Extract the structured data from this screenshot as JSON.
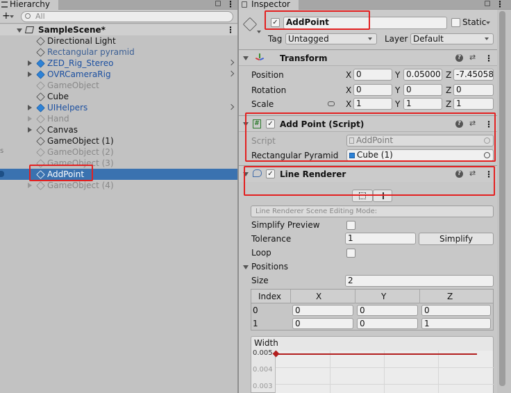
{
  "hierarchy": {
    "tab_label": "Hierarchy",
    "search_placeholder": "All",
    "scene_name": "SampleScene*",
    "items": [
      {
        "label": "Directional Light",
        "style": "normal"
      },
      {
        "label": "Rectangular pyramid",
        "style": "blue"
      },
      {
        "label": "ZED_Rig_Stereo",
        "style": "prefab"
      },
      {
        "label": "OVRCameraRig",
        "style": "prefab"
      },
      {
        "label": "GameObject",
        "style": "gray"
      },
      {
        "label": "Cube",
        "style": "normal"
      },
      {
        "label": "UIHelpers",
        "style": "prefab"
      },
      {
        "label": "Hand",
        "style": "gray"
      },
      {
        "label": "Canvas",
        "style": "normal"
      },
      {
        "label": "GameObject (1)",
        "style": "normal"
      },
      {
        "label": "GameObject (2)",
        "style": "gray"
      },
      {
        "label": "GameObject (3)",
        "style": "gray"
      },
      {
        "label": "AddPoint",
        "style": "selected"
      },
      {
        "label": "GameObject (4)",
        "style": "gray"
      }
    ]
  },
  "inspector": {
    "tab_label": "Inspector",
    "object_name": "AddPoint",
    "static_label": "Static",
    "tag_label": "Tag",
    "tag_value": "Untagged",
    "layer_label": "Layer",
    "layer_value": "Default",
    "transform": {
      "title": "Transform",
      "position_label": "Position",
      "rotation_label": "Rotation",
      "scale_label": "Scale",
      "x_label": "X",
      "y_label": "Y",
      "z_label": "Z",
      "position": {
        "x": "0",
        "y": "0.05000",
        "z": "-7.45058"
      },
      "rotation": {
        "x": "0",
        "y": "0",
        "z": "0"
      },
      "scale": {
        "x": "1",
        "y": "1",
        "z": "1"
      }
    },
    "add_point": {
      "title": "Add Point (Script)",
      "script_label": "Script",
      "script_value": "AddPoint",
      "pyramid_label": "Rectangular Pyramid",
      "pyramid_value": "Cube (1)"
    },
    "line_renderer": {
      "title": "Line Renderer",
      "editing_mode_label": "Line Renderer Scene Editing Mode:",
      "simplify_preview_label": "Simplify Preview",
      "tolerance_label": "Tolerance",
      "tolerance_value": "1",
      "simplify_button": "Simplify",
      "loop_label": "Loop",
      "positions_label": "Positions",
      "size_label": "Size",
      "size_value": "2",
      "table_headers": [
        "Index",
        "X",
        "Y",
        "Z"
      ],
      "rows": [
        {
          "index": "0",
          "x": "0",
          "y": "0",
          "z": "0"
        },
        {
          "index": "1",
          "x": "0",
          "y": "0",
          "z": "1"
        }
      ],
      "width_label": "Width",
      "width_ticks": [
        "0.005",
        "0.004",
        "0.003"
      ]
    }
  }
}
